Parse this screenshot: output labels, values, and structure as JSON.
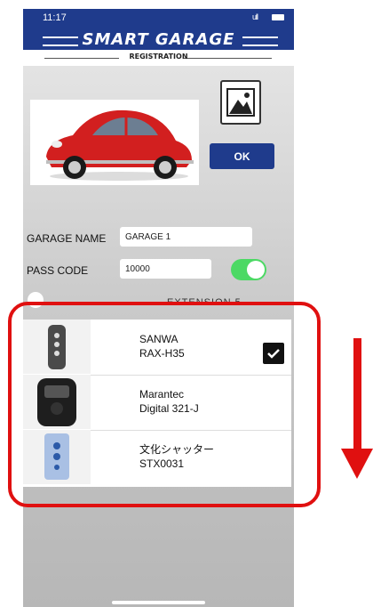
{
  "status": {
    "time": "11:17",
    "signal": "ull"
  },
  "header": {
    "brand": "SMART GARAGE",
    "subtitle": "REGISTRATION"
  },
  "buttons": {
    "ok": "OK"
  },
  "form": {
    "garage_name_label": "GARAGE NAME",
    "garage_name_value": "GARAGE 1",
    "pass_code_label": "PASS CODE",
    "pass_code_value": "10000",
    "toggle_on": true
  },
  "extension_label": "EXTENSION 5",
  "remotes": [
    {
      "brand": "SANWA",
      "model": "RAX-H35",
      "selected": true
    },
    {
      "brand": "Marantec",
      "model": "Digital 321-J",
      "selected": false
    },
    {
      "brand": "文化シャッター",
      "model": "STX0031",
      "selected": false
    }
  ],
  "colors": {
    "header_blue": "#1f3b8c",
    "ok_blue": "#1f3b8c",
    "toggle_green": "#4cd964",
    "highlight_red": "#e01010",
    "car_red": "#d21f1f"
  },
  "icons": {
    "image_button": "image-picker-icon",
    "check": "check-icon",
    "arrow": "down-arrow-icon"
  }
}
